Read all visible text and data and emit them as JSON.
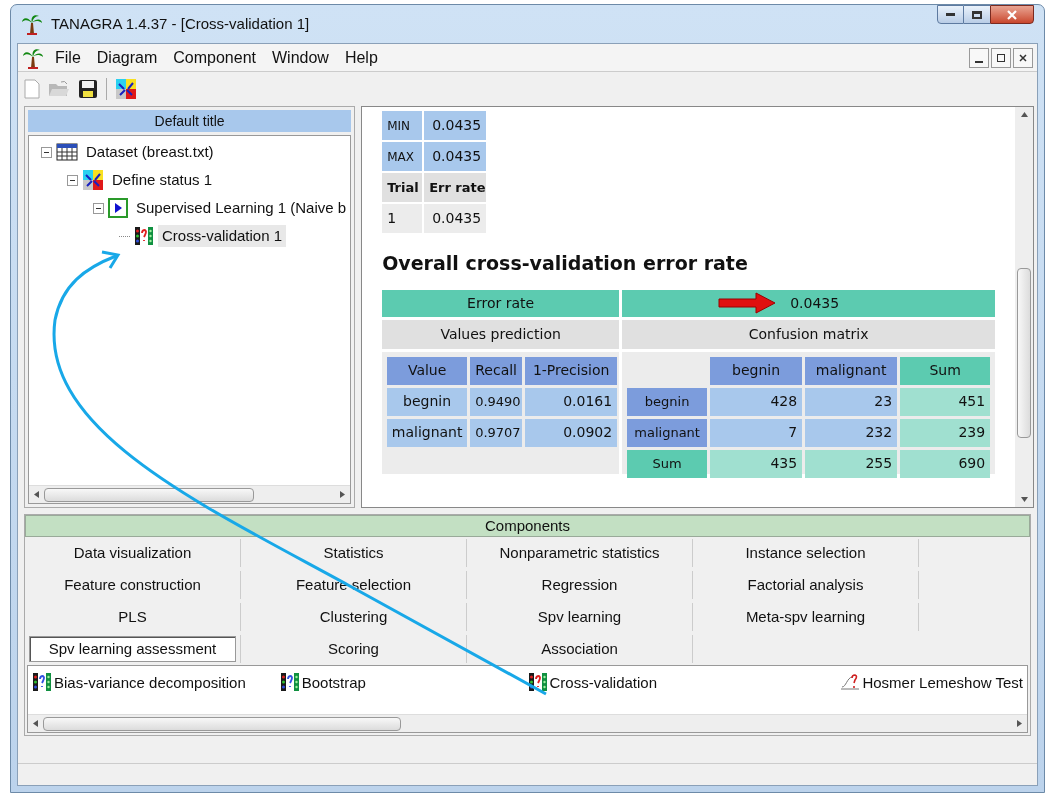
{
  "window": {
    "title": "TANAGRA 1.4.37 - [Cross-validation 1]"
  },
  "menu": [
    "File",
    "Diagram",
    "Component",
    "Window",
    "Help"
  ],
  "diagram": {
    "title": "Default title",
    "tree": [
      {
        "label": "Dataset (breast.txt)",
        "kind": "dataset",
        "expanded": true,
        "selected": false,
        "children": [
          {
            "label": "Define status 1",
            "kind": "status",
            "expanded": true,
            "selected": false,
            "children": [
              {
                "label": "Supervised Learning 1 (Naive b",
                "kind": "learner",
                "expanded": true,
                "selected": false,
                "children": [
                  {
                    "label": "Cross-validation 1",
                    "kind": "validation",
                    "selected": true
                  }
                ]
              }
            ]
          }
        ]
      }
    ]
  },
  "results": {
    "stats": [
      {
        "label": "MIN",
        "value": "0.0435"
      },
      {
        "label": "MAX",
        "value": "0.0435"
      }
    ],
    "trials": {
      "columns": [
        "Trial",
        "Err rate"
      ],
      "rows": [
        [
          "1",
          "0.0435"
        ]
      ]
    },
    "heading": "Overall cross-validation error rate",
    "error_rate": {
      "label": "Error rate",
      "value": "0.0435"
    },
    "values_prediction": {
      "title": "Values prediction",
      "columns": [
        "Value",
        "Recall",
        "1-Precision"
      ],
      "rows": [
        [
          "begnin",
          "0.9490",
          "0.0161"
        ],
        [
          "malignant",
          "0.9707",
          "0.0902"
        ]
      ]
    },
    "confusion_matrix": {
      "title": "Confusion matrix",
      "columns": [
        {
          "label": "begnin",
          "kind": "class"
        },
        {
          "label": "malignant",
          "kind": "class"
        },
        {
          "label": "Sum",
          "kind": "total"
        }
      ],
      "rows": [
        {
          "label": "begnin",
          "kind": "class",
          "cells": [
            "428",
            "23",
            "451"
          ]
        },
        {
          "label": "malignant",
          "kind": "class",
          "cells": [
            "7",
            "232",
            "239"
          ]
        },
        {
          "label": "Sum",
          "kind": "total",
          "cells": [
            "435",
            "255",
            "690"
          ]
        }
      ]
    }
  },
  "components": {
    "title": "Components",
    "tabs": [
      {
        "label": "Data visualization",
        "selected": false
      },
      {
        "label": "Statistics",
        "selected": false
      },
      {
        "label": "Nonparametric statistics",
        "selected": false
      },
      {
        "label": "Instance selection",
        "selected": false
      },
      {
        "label": "Feature construction",
        "selected": false
      },
      {
        "label": "Feature selection",
        "selected": false
      },
      {
        "label": "Regression",
        "selected": false
      },
      {
        "label": "Factorial analysis",
        "selected": false
      },
      {
        "label": "PLS",
        "selected": false
      },
      {
        "label": "Clustering",
        "selected": false
      },
      {
        "label": "Spv learning",
        "selected": false
      },
      {
        "label": "Meta-spv learning",
        "selected": false
      },
      {
        "label": "Spv learning assessment",
        "selected": true
      },
      {
        "label": "Scoring",
        "selected": false
      },
      {
        "label": "Association",
        "selected": false
      }
    ],
    "items": [
      {
        "label": "Bias-variance decomposition",
        "kind": "blue-meter"
      },
      {
        "label": "Bootstrap",
        "kind": "blue-meter"
      },
      {
        "label": "Cross-validation",
        "kind": "red-meter"
      },
      {
        "label": "Hosmer Lemeshow Test",
        "kind": "curve"
      }
    ]
  }
}
